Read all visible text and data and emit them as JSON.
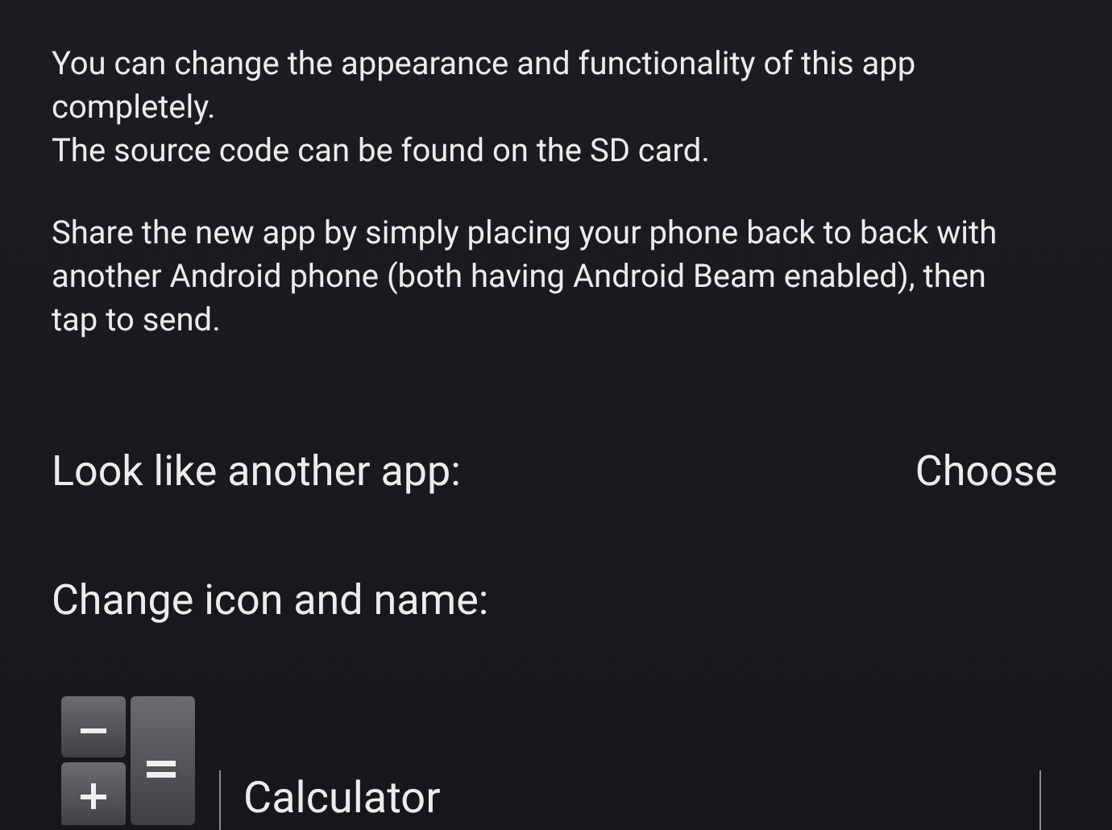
{
  "intro": [
    "You can change the appearance and functionality of this app completely.\nThe source code can be found on the SD card.",
    "Share the new app by simply placing your phone back to back with another Android phone (both having Android Beam enabled), then tap to send."
  ],
  "look_like": {
    "label": "Look like another app:",
    "button": "Choose"
  },
  "change_icon": {
    "label": "Change icon and name:"
  },
  "name_field": {
    "value": "Calculator"
  }
}
